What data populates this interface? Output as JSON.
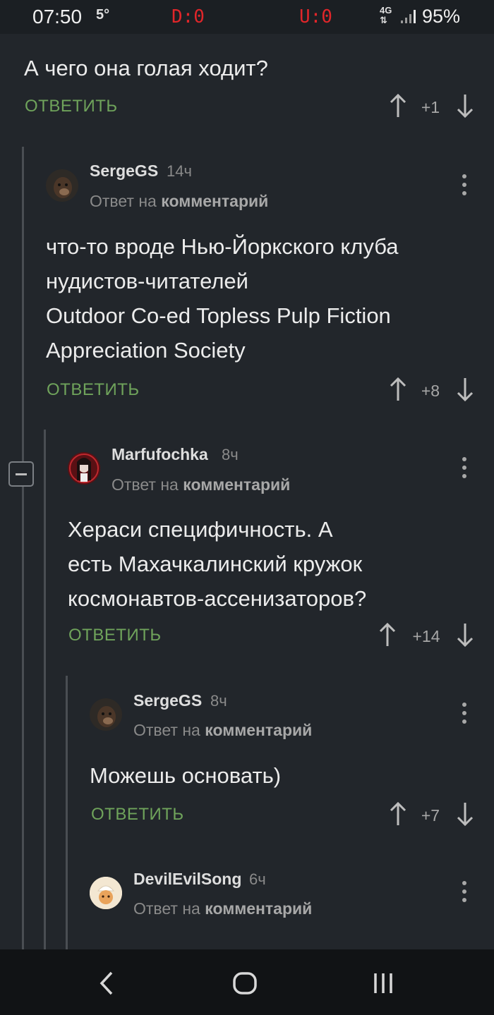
{
  "status_bar": {
    "time": "07:50",
    "notification": "5°",
    "download": "D:0",
    "upload": "U:0",
    "network_top": "4G",
    "network_bottom": "⇅",
    "battery": "95%"
  },
  "comments": [
    {
      "text_lines": [
        "А чего она голая ходит?"
      ],
      "reply_label": "ОТВЕТИТЬ",
      "score": "+1"
    },
    {
      "username": "SergeGS",
      "time": "14ч",
      "reply_to_prefix": "Ответ на",
      "reply_to_link": "комментарий",
      "text_lines": [
        "что-то вроде Нью-Йоркского клуба",
        "нудистов-читателей",
        "Outdoor Co-ed Topless Pulp Fiction",
        "Appreciation Society"
      ],
      "reply_label": "ОТВЕТИТЬ",
      "score": "+8"
    },
    {
      "username": "Marfufochka",
      "time": "8ч",
      "reply_to_prefix": "Ответ на",
      "reply_to_link": "комментарий",
      "text_lines": [
        "Хераси специфичность. А",
        "есть Махачкалинский кружок",
        "космонавтов-ассенизаторов?"
      ],
      "reply_label": "ОТВЕТИТЬ",
      "score": "+14"
    },
    {
      "username": "SergeGS",
      "time": "8ч",
      "reply_to_prefix": "Ответ на",
      "reply_to_link": "комментарий",
      "text_lines": [
        "Можешь основать)"
      ],
      "reply_label": "ОТВЕТИТЬ",
      "score": "+7"
    },
    {
      "username": "DevilEvilSong",
      "time": "6ч",
      "reply_to_prefix": "Ответ на",
      "reply_to_link": "комментарий"
    }
  ],
  "icons": {
    "upvote": "arrow-up-icon",
    "downvote": "arrow-down-icon",
    "more": "more-vertical-icon",
    "collapse": "minus-box-icon",
    "back": "back-icon",
    "home": "home-icon",
    "recent": "recent-apps-icon"
  },
  "colors": {
    "background": "#22262b",
    "reply_green": "#6fa35b",
    "status_red": "#e0262a"
  }
}
